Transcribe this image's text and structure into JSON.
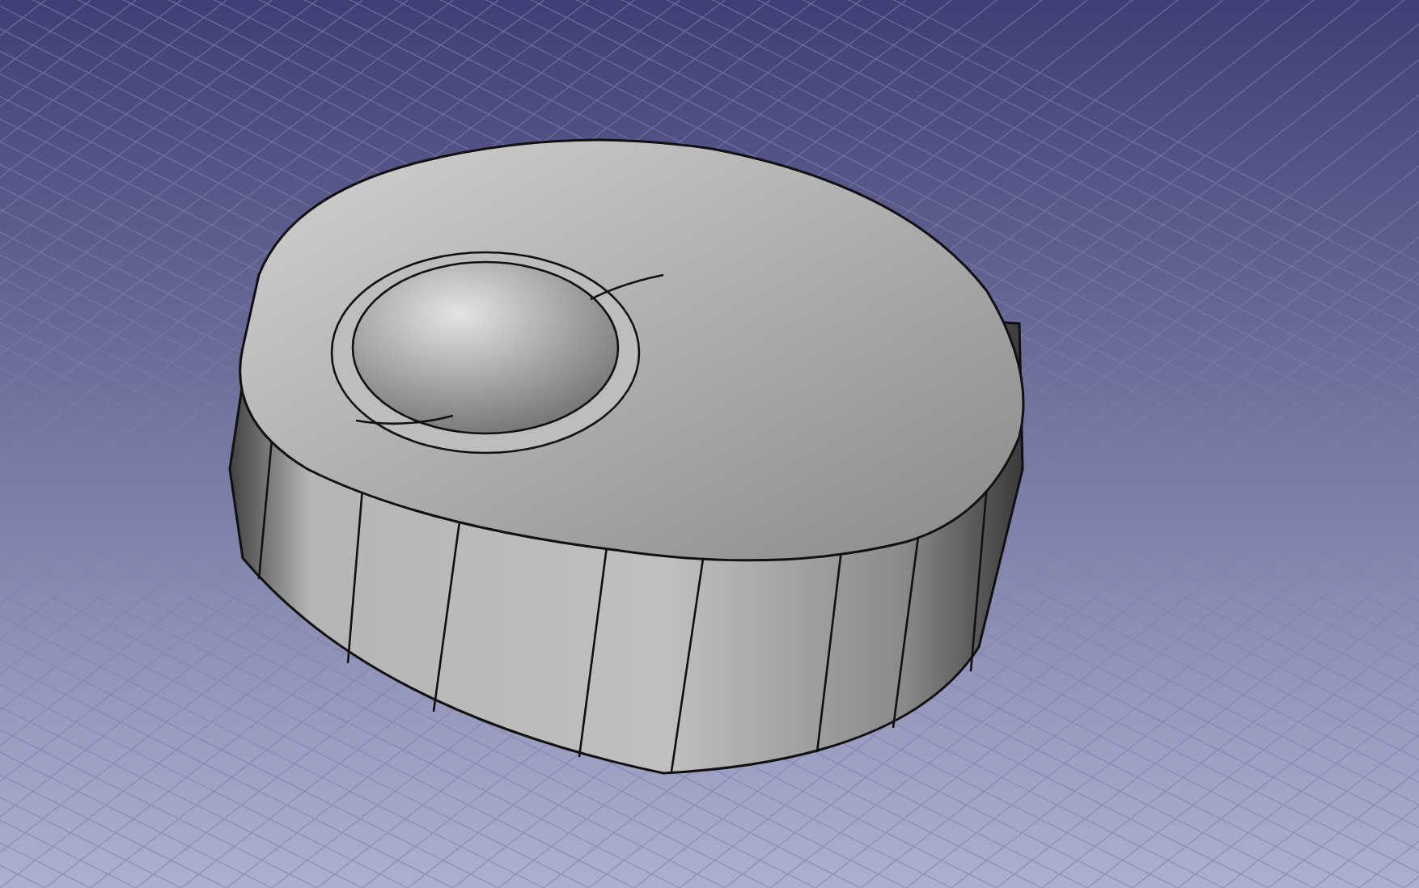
{
  "viewport": {
    "grid": true
  }
}
